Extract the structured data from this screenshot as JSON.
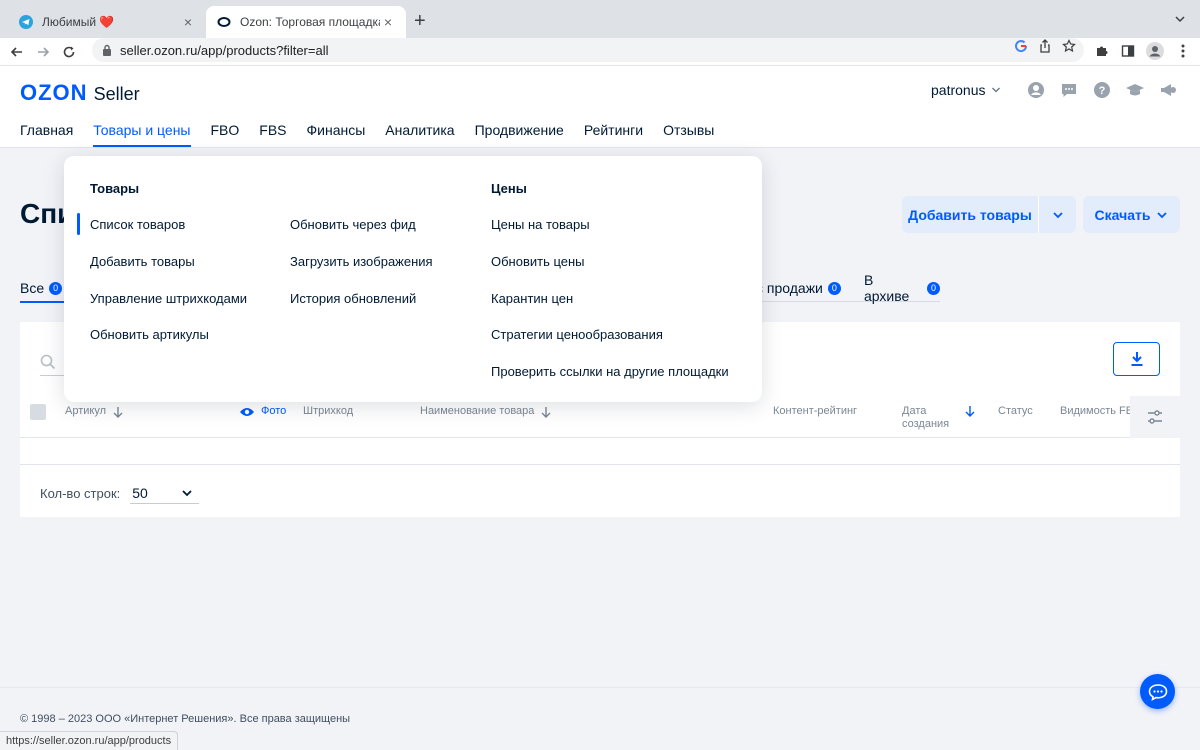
{
  "browser": {
    "tabs": [
      {
        "title": "Любимый ❤️",
        "close": "×"
      },
      {
        "title": "Ozon: Торговая площадка",
        "close": "×"
      }
    ],
    "new_tab": "+",
    "url": "seller.ozon.ru/app/products?filter=all",
    "status_url": "https://seller.ozon.ru/app/products"
  },
  "header": {
    "logo_ozon": "OZON",
    "logo_seller": "Seller",
    "user": "patronus",
    "nav": [
      "Главная",
      "Товары и цены",
      "FBO",
      "FBS",
      "Финансы",
      "Аналитика",
      "Продвижение",
      "Рейтинги",
      "Отзывы"
    ],
    "active_nav": "Товары и цены"
  },
  "page": {
    "title": "Спи",
    "add_button": "Добавить товары",
    "download_button": "Скачать",
    "filter_tabs": [
      {
        "label": "Все",
        "count": "0"
      },
      {
        "label": "с продажи",
        "count": "0"
      },
      {
        "label": "В архиве",
        "count": "0"
      }
    ],
    "columns": {
      "article": "Артикул",
      "photo": "Фото",
      "barcode": "Штрихкод",
      "name": "Наименование товара",
      "content_rating": "Контент-рейтинг",
      "created_1": "Дата",
      "created_2": "создания",
      "status": "Статус",
      "visibility": "Видимость FB"
    },
    "rows_label": "Кол-во строк:",
    "rows_value": "50"
  },
  "dropdown": {
    "goods_heading": "Товары",
    "prices_heading": "Цены",
    "goods_col1": [
      "Список товаров",
      "Добавить товары",
      "Управление штрихкодами",
      "Обновить артикулы"
    ],
    "goods_col2": [
      "Обновить через фид",
      "Загрузить изображения",
      "История обновлений"
    ],
    "prices": [
      "Цены на товары",
      "Обновить цены",
      "Карантин цен",
      "Стратегии ценообразования",
      "Проверить ссылки на другие площадки"
    ]
  },
  "footer": {
    "copyright": "© 1998 – 2023 ООО «Интернет Решения». Все права защищены"
  },
  "colors": {
    "brand": "#005bff",
    "text": "#001a34",
    "background": "#f2f3f7"
  }
}
